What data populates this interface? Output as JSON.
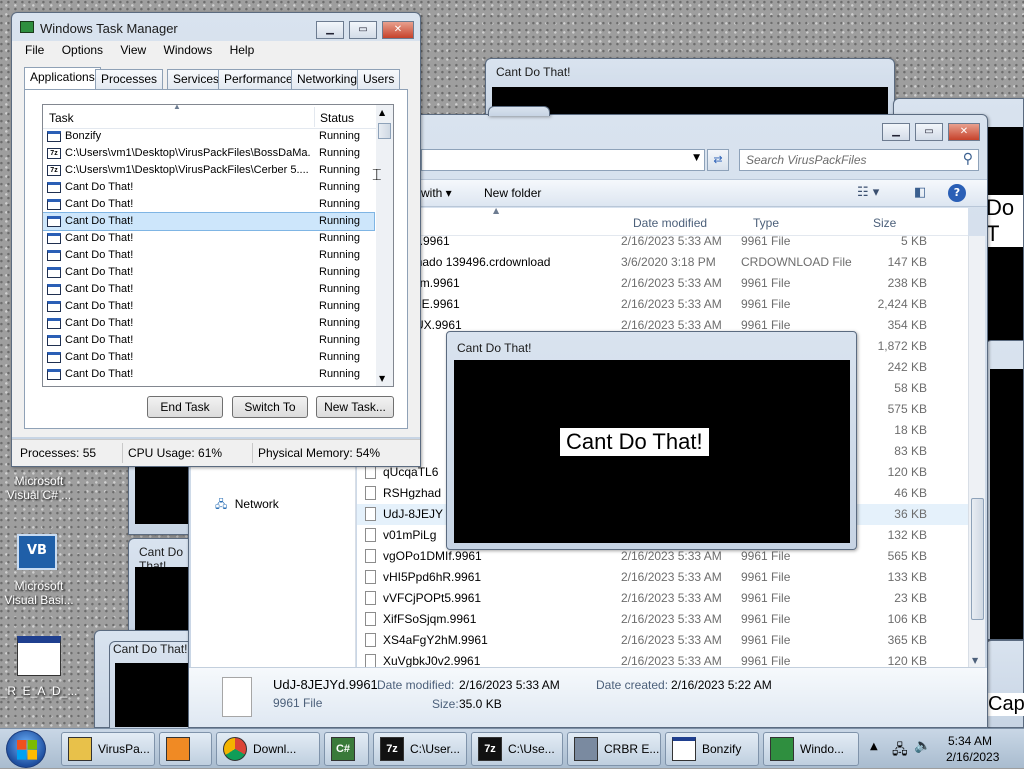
{
  "desktop": {
    "icons": [
      {
        "label": "Microsoft\nVisual C# ..."
      },
      {
        "label": "Microsoft\nVisual Basi..."
      },
      {
        "label": "_R_E_A_D_..."
      }
    ]
  },
  "popup_title": "Cant Do That!",
  "popup_message": "Cant Do That!",
  "explorer": {
    "search_placeholder": "Search VirusPackFiles",
    "toolbar_with": "with ▾",
    "new_folder": "New folder",
    "columns": {
      "date": "Date modified",
      "type": "Type",
      "size": "Size"
    },
    "nav_network": "Network",
    "files": [
      {
        "name": "-dWPn.9961",
        "date": "2/16/2023 5:33 AM",
        "type": "9961 File",
        "size": "5 KB"
      },
      {
        "name": "confirmado 139496.crdownload",
        "date": "3/6/2020 3:18 PM",
        "type": "CRDOWNLOAD File",
        "size": "147 KB"
      },
      {
        "name": "KnaHgm.9961",
        "date": "2/16/2023 5:33 AM",
        "type": "9961 File",
        "size": "238 KB"
      },
      {
        "name": "KxbniCE.9961",
        "date": "2/16/2023 5:33 AM",
        "type": "9961 File",
        "size": "2,424 KB"
      },
      {
        "name": "ZMELUX.9961",
        "date": "2/16/2023 5:33 AM",
        "type": "9961 File",
        "size": "354 KB"
      },
      {
        "name": "DOb",
        "date": "",
        "type": "",
        "size": "1,872 KB"
      },
      {
        "name": "rnD4",
        "date": "",
        "type": "",
        "size": "242 KB"
      },
      {
        "name": "Zd2lI",
        "date": "",
        "type": "",
        "size": "58 KB"
      },
      {
        "name": "W-k",
        "date": "",
        "type": "",
        "size": "575 KB"
      },
      {
        "name": "Hlo8",
        "date": "",
        "type": "",
        "size": "18 KB"
      },
      {
        "name": "N6Fz",
        "date": "",
        "type": "",
        "size": "83 KB"
      },
      {
        "name": "qUcqaTL6",
        "date": "",
        "type": "",
        "size": "120 KB"
      },
      {
        "name": "RSHgzhad",
        "date": "",
        "type": "",
        "size": "46 KB"
      },
      {
        "name": "UdJ-8JEJY",
        "date": "",
        "type": "",
        "size": "36 KB"
      },
      {
        "name": "v01mPiLg",
        "date": "",
        "type": "",
        "size": "132 KB"
      },
      {
        "name": "vgOPo1DMIf.9961",
        "date": "2/16/2023 5:33 AM",
        "type": "9961 File",
        "size": "565 KB"
      },
      {
        "name": "vHI5Ppd6hR.9961",
        "date": "2/16/2023 5:33 AM",
        "type": "9961 File",
        "size": "133 KB"
      },
      {
        "name": "vVFCjPOPt5.9961",
        "date": "2/16/2023 5:33 AM",
        "type": "9961 File",
        "size": "23 KB"
      },
      {
        "name": "XifFSoSjqm.9961",
        "date": "2/16/2023 5:33 AM",
        "type": "9961 File",
        "size": "106 KB"
      },
      {
        "name": "XS4aFgY2hM.9961",
        "date": "2/16/2023 5:33 AM",
        "type": "9961 File",
        "size": "365 KB"
      },
      {
        "name": "XuVgbkJ0v2.9961",
        "date": "2/16/2023 5:33 AM",
        "type": "9961 File",
        "size": "120 KB"
      }
    ],
    "details": {
      "name": "UdJ-8JEJYd.9961",
      "type": "9961 File",
      "modified_label": "Date modified:",
      "modified": "2/16/2023 5:33 AM",
      "created_label": "Date created:",
      "created": "2/16/2023 5:22 AM",
      "size_label": "Size:",
      "size": "35.0 KB"
    }
  },
  "task_manager": {
    "title": "Windows Task Manager",
    "menu": [
      "File",
      "Options",
      "View",
      "Windows",
      "Help"
    ],
    "tabs": [
      "Applications",
      "Processes",
      "Services",
      "Performance",
      "Networking",
      "Users"
    ],
    "col_task": "Task",
    "col_status": "Status",
    "tasks": [
      {
        "name": "Bonzify",
        "status": "Running",
        "icon": "window"
      },
      {
        "name": "C:\\Users\\vm1\\Desktop\\VirusPackFiles\\BossDaMa...",
        "status": "Running",
        "icon": "7z"
      },
      {
        "name": "C:\\Users\\vm1\\Desktop\\VirusPackFiles\\Cerber 5....",
        "status": "Running",
        "icon": "7z"
      },
      {
        "name": "Cant Do That!",
        "status": "Running",
        "icon": "window"
      },
      {
        "name": "Cant Do That!",
        "status": "Running",
        "icon": "window"
      },
      {
        "name": "Cant Do That!",
        "status": "Running",
        "icon": "window"
      },
      {
        "name": "Cant Do That!",
        "status": "Running",
        "icon": "window"
      },
      {
        "name": "Cant Do That!",
        "status": "Running",
        "icon": "window"
      },
      {
        "name": "Cant Do That!",
        "status": "Running",
        "icon": "window"
      },
      {
        "name": "Cant Do That!",
        "status": "Running",
        "icon": "window"
      },
      {
        "name": "Cant Do That!",
        "status": "Running",
        "icon": "window"
      },
      {
        "name": "Cant Do That!",
        "status": "Running",
        "icon": "window"
      },
      {
        "name": "Cant Do That!",
        "status": "Running",
        "icon": "window"
      },
      {
        "name": "Cant Do That!",
        "status": "Running",
        "icon": "window"
      },
      {
        "name": "Cant Do That!",
        "status": "Running",
        "icon": "window"
      }
    ],
    "selected_index": 5,
    "buttons": {
      "end_task": "End Task",
      "switch_to": "Switch To",
      "new_task": "New Task..."
    },
    "status": {
      "processes": "Processes: 55",
      "cpu": "CPU Usage: 61%",
      "memory": "Physical Memory: 54%"
    }
  },
  "taskbar": {
    "buttons": [
      {
        "label": "VirusPa...",
        "icon": "folder-icon"
      },
      {
        "label": "",
        "icon": "media-player-icon"
      },
      {
        "label": "Downl...",
        "icon": "chrome-icon"
      },
      {
        "label": "",
        "icon": "csharp-icon"
      },
      {
        "label": "C:\\User...",
        "icon": "7zip-icon"
      },
      {
        "label": "C:\\Use...",
        "icon": "7zip-icon"
      },
      {
        "label": "CRBR E...",
        "icon": "app-icon"
      },
      {
        "label": "Bonzify",
        "icon": "window-icon"
      },
      {
        "label": "Windo...",
        "icon": "task-manager-icon"
      }
    ],
    "time": "5:34 AM",
    "date": "2/16/2023"
  },
  "colors": {
    "accent": "#2a5fb6",
    "selection": "#cde6fb",
    "popup_bg": "#000000"
  }
}
